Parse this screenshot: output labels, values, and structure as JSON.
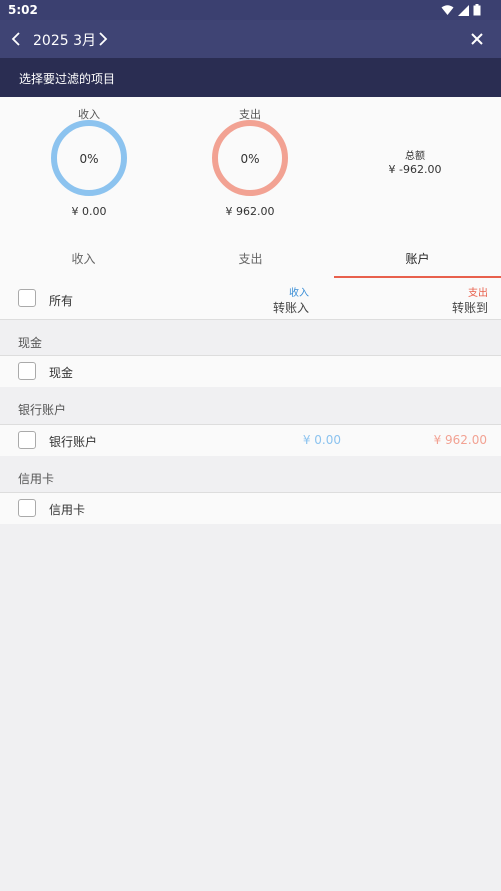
{
  "status": {
    "time": "5:02"
  },
  "header": {
    "month": "2025 3月"
  },
  "subbar": {
    "title": "选择要过滤的项目"
  },
  "summary": {
    "income": {
      "title": "收入",
      "percent": "0%",
      "amount": "¥ 0.00",
      "color": "#8cc3ef"
    },
    "expense": {
      "title": "支出",
      "percent": "0%",
      "amount": "¥ 962.00",
      "color": "#f2a293"
    },
    "total": {
      "label": "总额",
      "value": "¥ -962.00"
    }
  },
  "tabs": [
    {
      "label": "收入",
      "active": false
    },
    {
      "label": "支出",
      "active": false
    },
    {
      "label": "账户",
      "active": true
    }
  ],
  "all_row": {
    "label": "所有",
    "in_small": "收入",
    "in_label": "转账入",
    "out_small": "支出",
    "out_label": "转账到",
    "in_color": "#3b8ed6",
    "out_color": "#e8604c"
  },
  "sections": [
    {
      "title": "现金",
      "item": "现金",
      "in": "",
      "out": ""
    },
    {
      "title": "银行账户",
      "item": "银行账户",
      "in": "¥ 0.00",
      "out": "¥ 962.00"
    },
    {
      "title": "信用卡",
      "item": "信用卡",
      "in": "",
      "out": ""
    }
  ]
}
